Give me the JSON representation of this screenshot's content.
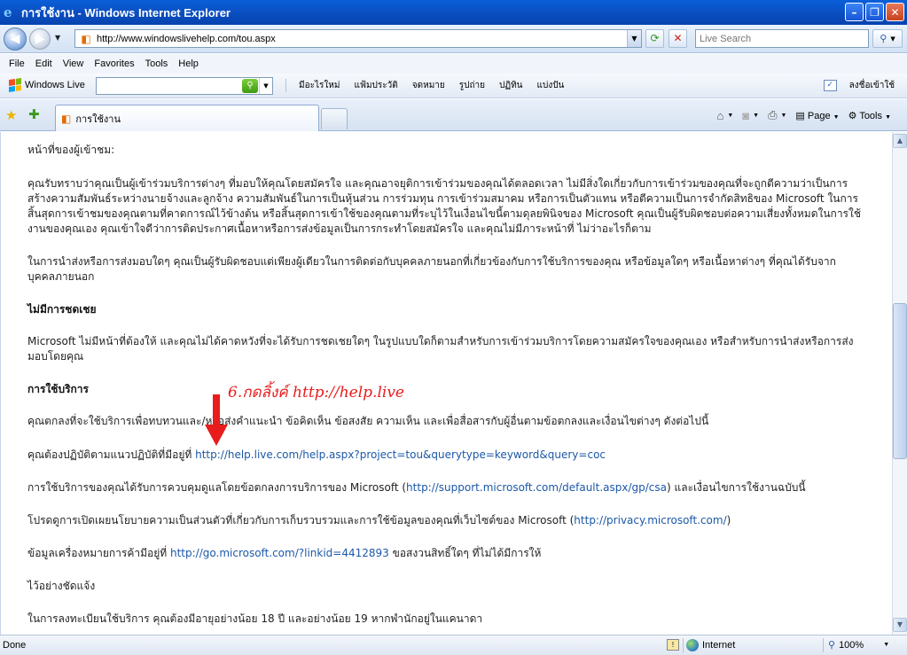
{
  "window": {
    "title": "การใช้งาน - Windows Internet Explorer",
    "min": "–",
    "max": "❐",
    "close": "✕"
  },
  "address": {
    "url": "http://www.windowslivehelp.com/tou.aspx",
    "search_placeholder": "Live Search"
  },
  "menu": [
    "File",
    "Edit",
    "View",
    "Favorites",
    "Tools",
    "Help"
  ],
  "live_toolbar": {
    "logo": "Windows Live",
    "links": [
      "มีอะไรใหม่",
      "แฟ้มประวัติ",
      "จดหมาย",
      "รูปถ่าย",
      "ปฏิทิน",
      "แบ่งปัน"
    ],
    "signin": "ลงชื่อเข้าใช้"
  },
  "tab": {
    "title": "การใช้งาน"
  },
  "command_bar": {
    "page": "Page",
    "tools": "Tools"
  },
  "content": {
    "p1": "หน้าที่ของผู้เข้าชม:",
    "p2": "คุณรับทราบว่าคุณเป็นผู้เข้าร่วมบริการต่างๆ ที่มอบให้คุณโดยสมัครใจ และคุณอาจยุติการเข้าร่วมของคุณได้ตลอดเวลา ไม่มีสิ่งใดเกี่ยวกับการเข้าร่วมของคุณที่จะถูกตีความว่าเป็นการสร้างความสัมพันธ์ระหว่างนายจ้างและลูกจ้าง ความสัมพันธ์ในการเป็นหุ้นส่วน การร่วมทุน การเข้าร่วมสมาคม หรือการเป็นตัวแทน หรือตีความเป็นการจำกัดสิทธิของ Microsoft ในการสิ้นสุดการเข้าชมของคุณตามที่คาดการณ์ไว้ข้างต้น หรือสิ้นสุดการเข้าใช้ของคุณตามที่ระบุไว้ในเงื่อนไขนี้ตามดุลยพินิจของ Microsoft คุณเป็นผู้รับผิดชอบต่อความเสี่ยงทั้งหมดในการใช้งานของคุณเอง คุณเข้าใจดีว่าการติดประกาศเนื้อหาหรือการส่งข้อมูลเป็นการกระทำโดยสมัครใจ และคุณไม่มีภาระหน้าที่ ไม่ว่าอะไรก็ตาม",
    "p3": "ในการนำส่งหรือการส่งมอบใดๆ คุณเป็นผู้รับผิดชอบแต่เพียงผู้เดียวในการติดต่อกับบุคคลภายนอกที่เกี่ยวข้องกับการใช้บริการของคุณ หรือข้อมูลใดๆ หรือเนื้อหาต่างๆ ที่คุณได้รับจากบุคคลภายนอก",
    "h1": "ไม่มีการชดเชย",
    "p4": "Microsoft ไม่มีหน้าที่ต้องให้ และคุณไม่ได้คาดหวังที่จะได้รับการชดเชยใดๆ ในรูปแบบใดก็ตามสำหรับการเข้าร่วมบริการโดยความสมัครใจของคุณเอง หรือสำหรับการนำส่งหรือการส่งมอบโดยคุณ",
    "h2": "การใช้บริการ",
    "p5": "คุณตกลงที่จะใช้บริการเพื่อทบทวนและ/หรือส่งคำแนะนำ ข้อคิดเห็น ข้อสงสัย ความเห็น และเพื่อสื่อสารกับผู้อื่นตามข้อตกลงและเงื่อนไขต่างๆ ดังต่อไปนี้",
    "p6_text": "คุณต้องปฏิบัติตามแนวปฏิบัติที่มีอยู่ที่ ",
    "p6_link": "http://help.live.com/help.aspx?project=tou&querytype=keyword&query=coc",
    "p7_text": "การใช้บริการของคุณได้รับการควบคุมดูแลโดยข้อตกลงการบริการของ Microsoft (",
    "p7_link": "http://support.microsoft.com/default.aspx/gp/csa",
    "p7_tail": ") และเงื่อนไขการใช้งานฉบับนี้",
    "p8_text": "โปรดดูการเปิดเผยนโยบายความเป็นส่วนตัวที่เกี่ยวกับการเก็บรวบรวมและการใช้ข้อมูลของคุณที่เว็บไซต์ของ Microsoft (",
    "p8_link": "http://privacy.microsoft.com/",
    "p8_tail": ")",
    "p9_text": "ข้อมูลเครื่องหมายการค้ามีอยู่ที่ ",
    "p9_link": "http://go.microsoft.com/?linkid=4412893",
    "p9_tail": " ขอสงวนสิทธิ์ใดๆ ที่ไม่ได้มีการให้",
    "p10": "ไว้อย่างชัดแจ้ง",
    "p11": "ในการลงทะเบียนใช้บริการ คุณต้องมีอายุอย่างน้อย 18 ปี และอย่างน้อย 19 หากพำนักอยู่ในแคนาดา"
  },
  "annotation": "6.กดลิ้งค์ http://help.live",
  "status": {
    "text": "Done",
    "zone": "Internet",
    "zoom": "100%"
  }
}
